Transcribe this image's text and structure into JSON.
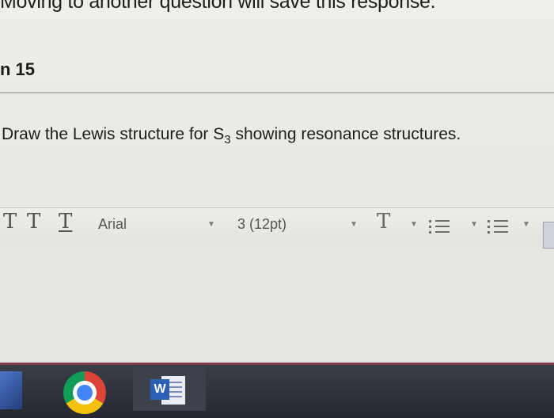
{
  "notice": "Moving to another question will save this response.",
  "question": {
    "header": "n 15",
    "prompt_main": "Draw the Lewis structure for S",
    "prompt_sub": "3",
    "prompt_tail": " showing resonance structures."
  },
  "toolbar": {
    "font_family": "Arial",
    "font_size": "3 (12pt)",
    "arrow_glyph": "▼"
  },
  "taskbar": {
    "word_letter": "W"
  },
  "colors": {
    "taskbar_accent": "#823a4a",
    "word_blue": "#2b5fb4"
  }
}
